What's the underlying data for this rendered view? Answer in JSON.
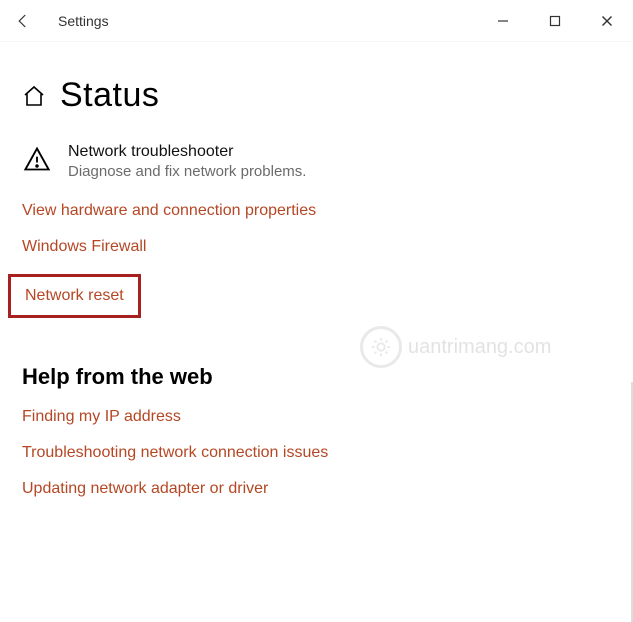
{
  "titlebar": {
    "app_name": "Settings"
  },
  "page": {
    "title": "Status"
  },
  "troubleshooter": {
    "title": "Network troubleshooter",
    "desc": "Diagnose and fix network problems."
  },
  "links": {
    "view_hardware": "View hardware and connection properties",
    "windows_firewall": "Windows Firewall",
    "network_reset": "Network reset"
  },
  "help": {
    "heading": "Help from the web",
    "items": [
      "Finding my IP address",
      "Troubleshooting network connection issues",
      "Updating network adapter or driver"
    ]
  },
  "watermark": {
    "text": "uantrimang.com"
  }
}
